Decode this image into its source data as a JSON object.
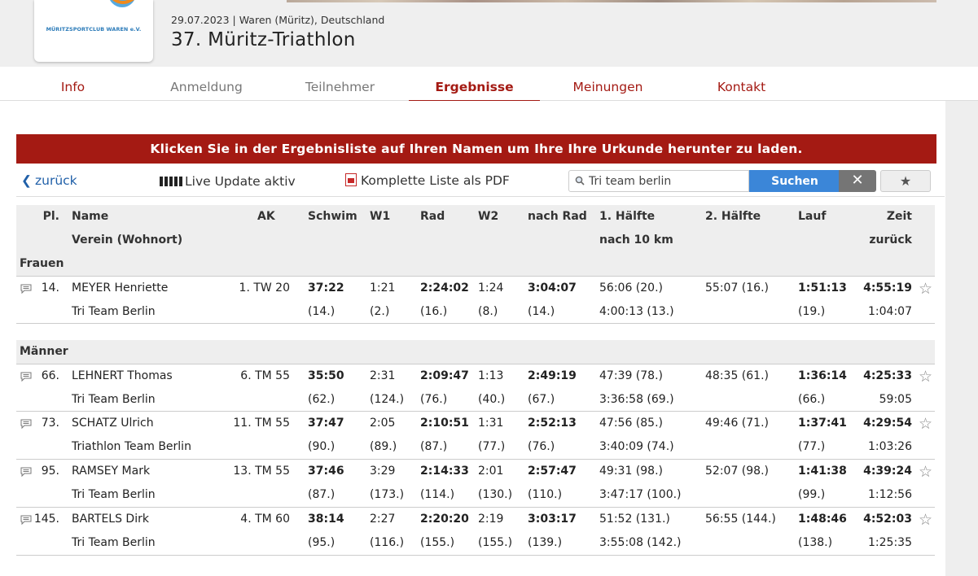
{
  "header": {
    "logo_text": "MÜRITZSPORTCLUB WAREN e.V.",
    "event_meta": "29.07.2023 | Waren (Müritz), Deutschland",
    "event_title": "37. Müritz-Triathlon"
  },
  "nav": {
    "tabs": [
      {
        "label": "Info"
      },
      {
        "label": "Anmeldung"
      },
      {
        "label": "Teilnehmer"
      },
      {
        "label": "Ergebnisse",
        "active": true
      },
      {
        "label": "Meinungen"
      },
      {
        "label": "Kontakt"
      }
    ]
  },
  "banner": "Klicken Sie in der Ergebnisliste auf Ihren Namen um Ihre Ihre Urkunde herunter zu laden.",
  "toolbar": {
    "back": "zurück",
    "live": "Live Update aktiv",
    "pdf": "Komplette Liste als PDF",
    "search_value": "Tri team berlin",
    "search_button": "Suchen",
    "clear": "✕",
    "favorite": "★"
  },
  "table": {
    "headers": {
      "place": "Pl.",
      "name": "Name",
      "club": "Verein (Wohnort)",
      "ak": "AK",
      "swim": "Schwim",
      "w1": "W1",
      "bike": "Rad",
      "w2": "W2",
      "after_bike": "nach Rad",
      "half1": "1. Hälfte",
      "half1_sub": "nach 10 km",
      "half2": "2. Hälfte",
      "run": "Lauf",
      "time": "Zeit",
      "time_sub": "zurück"
    },
    "groups": [
      {
        "label": "Frauen",
        "rows": [
          {
            "place": "14.",
            "name": "MEYER Henriette",
            "club": "Tri Team Berlin",
            "ak": "1. TW 20",
            "swim": "37:22",
            "swim_rank": "(14.)",
            "w1": "1:21",
            "w1_rank": "(2.)",
            "bike": "2:24:02",
            "bike_rank": "(16.)",
            "w2": "1:24",
            "w2_rank": "(8.)",
            "after_bike": "3:04:07",
            "after_bike_rank": "(14.)",
            "half1": "56:06 (20.)",
            "half1_sub": "4:00:13 (13.)",
            "half2": "55:07 (16.)",
            "run": "1:51:13",
            "run_rank": "(19.)",
            "time": "4:55:19",
            "behind": "1:04:07"
          }
        ]
      },
      {
        "label": "Männer",
        "rows": [
          {
            "place": "66.",
            "name": "LEHNERT Thomas",
            "club": "Tri Team Berlin",
            "ak": "6. TM 55",
            "swim": "35:50",
            "swim_rank": "(62.)",
            "w1": "2:31",
            "w1_rank": "(124.)",
            "bike": "2:09:47",
            "bike_rank": "(76.)",
            "w2": "1:13",
            "w2_rank": "(40.)",
            "after_bike": "2:49:19",
            "after_bike_rank": "(67.)",
            "half1": "47:39 (78.)",
            "half1_sub": "3:36:58 (69.)",
            "half2": "48:35 (61.)",
            "run": "1:36:14",
            "run_rank": "(66.)",
            "time": "4:25:33",
            "behind": "59:05"
          },
          {
            "place": "73.",
            "name": "SCHATZ Ulrich",
            "club": "Triathlon Team Berlin",
            "ak": "11. TM 55",
            "swim": "37:47",
            "swim_rank": "(90.)",
            "w1": "2:05",
            "w1_rank": "(89.)",
            "bike": "2:10:51",
            "bike_rank": "(87.)",
            "w2": "1:31",
            "w2_rank": "(77.)",
            "after_bike": "2:52:13",
            "after_bike_rank": "(76.)",
            "half1": "47:56 (85.)",
            "half1_sub": "3:40:09 (74.)",
            "half2": "49:46 (71.)",
            "run": "1:37:41",
            "run_rank": "(77.)",
            "time": "4:29:54",
            "behind": "1:03:26"
          },
          {
            "place": "95.",
            "name": "RAMSEY Mark",
            "club": "Tri Team Berlin",
            "ak": "13. TM 55",
            "swim": "37:46",
            "swim_rank": "(87.)",
            "w1": "3:29",
            "w1_rank": "(173.)",
            "bike": "2:14:33",
            "bike_rank": "(114.)",
            "w2": "2:01",
            "w2_rank": "(130.)",
            "after_bike": "2:57:47",
            "after_bike_rank": "(110.)",
            "half1": "49:31 (98.)",
            "half1_sub": "3:47:17 (100.)",
            "half2": "52:07 (98.)",
            "run": "1:41:38",
            "run_rank": "(99.)",
            "time": "4:39:24",
            "behind": "1:12:56"
          },
          {
            "place": "145.",
            "name": "BARTELS Dirk",
            "club": "Tri Team Berlin",
            "ak": "4. TM 60",
            "swim": "38:14",
            "swim_rank": "(95.)",
            "w1": "2:27",
            "w1_rank": "(116.)",
            "bike": "2:20:20",
            "bike_rank": "(155.)",
            "w2": "2:19",
            "w2_rank": "(155.)",
            "after_bike": "3:03:17",
            "after_bike_rank": "(139.)",
            "half1": "51:52 (131.)",
            "half1_sub": "3:55:08 (142.)",
            "half2": "56:55 (144.)",
            "run": "1:48:46",
            "run_rank": "(138.)",
            "time": "4:52:03",
            "behind": "1:25:35"
          }
        ]
      }
    ]
  }
}
